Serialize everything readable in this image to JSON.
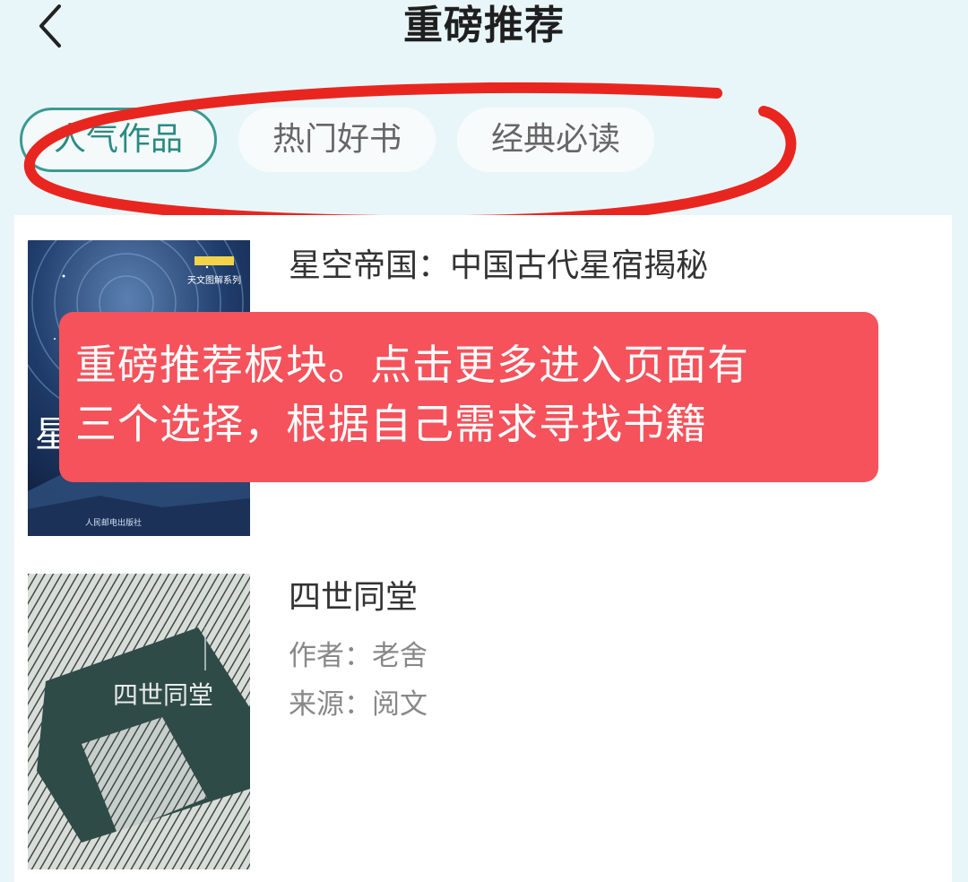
{
  "header": {
    "title": "重磅推荐",
    "back_icon": "chevron-left-icon"
  },
  "tabs": [
    {
      "label": "人气作品",
      "active": true
    },
    {
      "label": "热门好书",
      "active": false
    },
    {
      "label": "经典必读",
      "active": false
    }
  ],
  "books": [
    {
      "title": "星空帝国：中国古代星宿揭秘",
      "cover_text": "星宿",
      "cover_badge": "天文图解系列",
      "cover_publisher": "人民邮电出版社"
    },
    {
      "title": "四世同堂",
      "author_line": "作者：老舍",
      "source_line": "来源：阅文",
      "cover_text": "四世同堂"
    }
  ],
  "annotation": {
    "line1": "重磅推荐板块。点击更多进入页面有",
    "line2": "三个选择，根据自己需求寻找书籍",
    "background": "#f5525b",
    "ellipse_color": "#e8261f"
  },
  "colors": {
    "accent": "#3b9a94",
    "page_bg": "#e9f6f9"
  }
}
